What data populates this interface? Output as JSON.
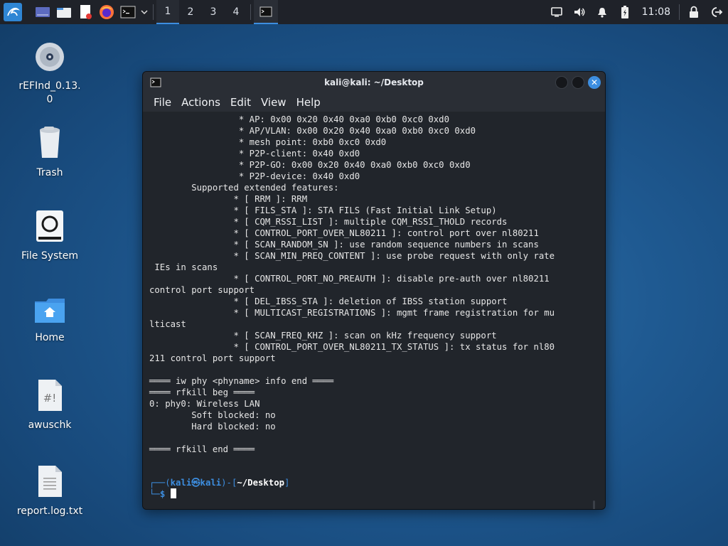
{
  "panel": {
    "workspaces": [
      "1",
      "2",
      "3",
      "4"
    ],
    "active_workspace": "1",
    "clock": "11:08"
  },
  "desktop": {
    "icons": [
      {
        "label": "rEFInd_0.13.\n0"
      },
      {
        "label": "Trash"
      },
      {
        "label": "File System"
      },
      {
        "label": "Home"
      },
      {
        "label": "awuschk"
      },
      {
        "label": "report.log.txt"
      }
    ]
  },
  "terminal": {
    "title": "kali@kali: ~/Desktop",
    "menu": [
      "File",
      "Actions",
      "Edit",
      "View",
      "Help"
    ],
    "lines": [
      "                 * AP: 0x00 0x20 0x40 0xa0 0xb0 0xc0 0xd0",
      "                 * AP/VLAN: 0x00 0x20 0x40 0xa0 0xb0 0xc0 0xd0",
      "                 * mesh point: 0xb0 0xc0 0xd0",
      "                 * P2P-client: 0x40 0xd0",
      "                 * P2P-GO: 0x00 0x20 0x40 0xa0 0xb0 0xc0 0xd0",
      "                 * P2P-device: 0x40 0xd0",
      "        Supported extended features:",
      "                * [ RRM ]: RRM",
      "                * [ FILS_STA ]: STA FILS (Fast Initial Link Setup)",
      "                * [ CQM_RSSI_LIST ]: multiple CQM_RSSI_THOLD records",
      "                * [ CONTROL_PORT_OVER_NL80211 ]: control port over nl80211",
      "                * [ SCAN_RANDOM_SN ]: use random sequence numbers in scans",
      "                * [ SCAN_MIN_PREQ_CONTENT ]: use probe request with only rate",
      " IEs in scans",
      "                * [ CONTROL_PORT_NO_PREAUTH ]: disable pre-auth over nl80211",
      "control port support",
      "                * [ DEL_IBSS_STA ]: deletion of IBSS station support",
      "                * [ MULTICAST_REGISTRATIONS ]: mgmt frame registration for mu",
      "lticast",
      "                * [ SCAN_FREQ_KHZ ]: scan on kHz frequency support",
      "                * [ CONTROL_PORT_OVER_NL80211_TX_STATUS ]: tx status for nl80",
      "211 control port support",
      "",
      "════ iw phy <phyname> info end ════",
      "════ rfkill beg ════",
      "0: phy0: Wireless LAN",
      "        Soft blocked: no",
      "        Hard blocked: no",
      "",
      "════ rfkill end ════"
    ],
    "prompt": {
      "open": "┌──(",
      "user": "kali㉿kali",
      "mid": ")-[",
      "path": "~/Desktop",
      "close": "]",
      "line2": "└─",
      "symbol": "$"
    }
  }
}
